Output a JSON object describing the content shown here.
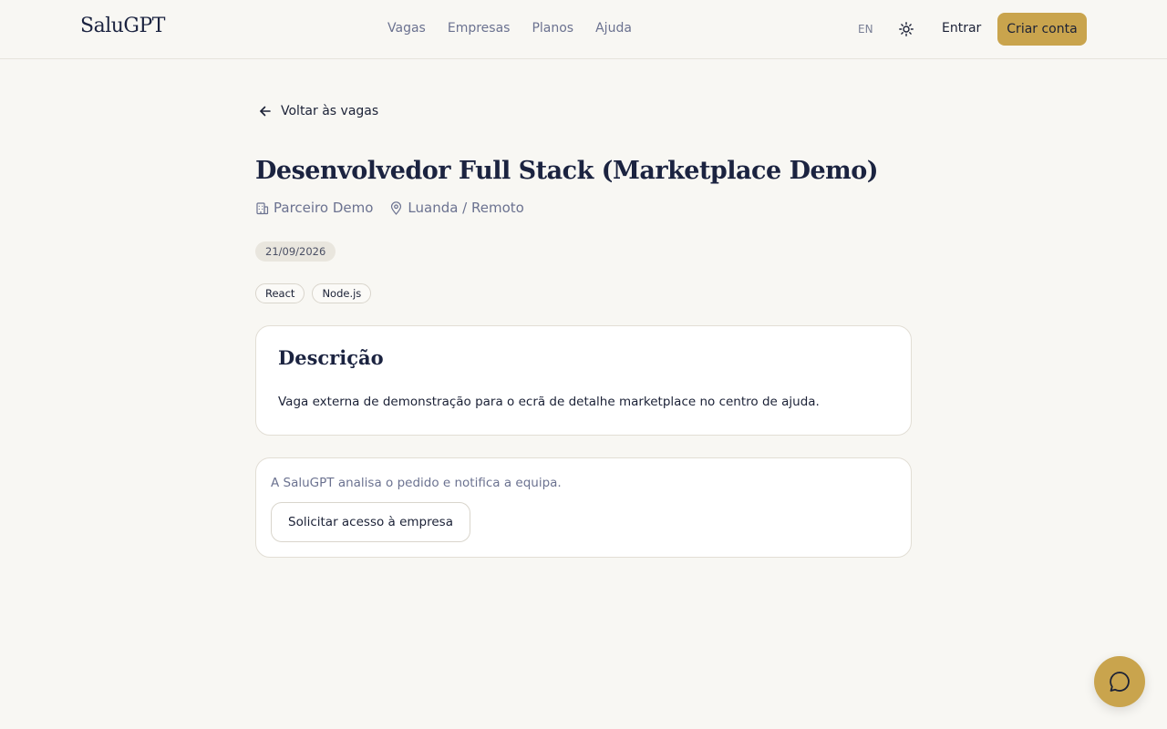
{
  "header": {
    "logo": "SaluGPT",
    "nav": [
      {
        "label": "Vagas"
      },
      {
        "label": "Empresas"
      },
      {
        "label": "Planos"
      },
      {
        "label": "Ajuda"
      }
    ],
    "lang": "EN",
    "theme_icon": "sun-icon",
    "login_label": "Entrar",
    "signup_label": "Criar conta"
  },
  "main": {
    "back_label": "Voltar às vagas",
    "job_title": "Desenvolvedor Full Stack (Marketplace Demo)",
    "company": "Parceiro Demo",
    "location": "Luanda / Remoto",
    "date": "21/09/2026",
    "tags": [
      "React",
      "Node.js"
    ],
    "description": {
      "heading": "Descrição",
      "text": "Vaga externa de demonstração para o ecrã de detalhe marketplace no centro de ajuda."
    },
    "access": {
      "note": "A SaluGPT analisa o pedido e notifica a equipa.",
      "button_label": "Solicitar acesso à empresa"
    }
  },
  "chat": {
    "icon": "chat-bubble-icon"
  },
  "colors": {
    "accent": "#c9a44d",
    "background": "#f8f7f3",
    "text_dark": "#1b2136",
    "text_muted": "#6b7290"
  }
}
